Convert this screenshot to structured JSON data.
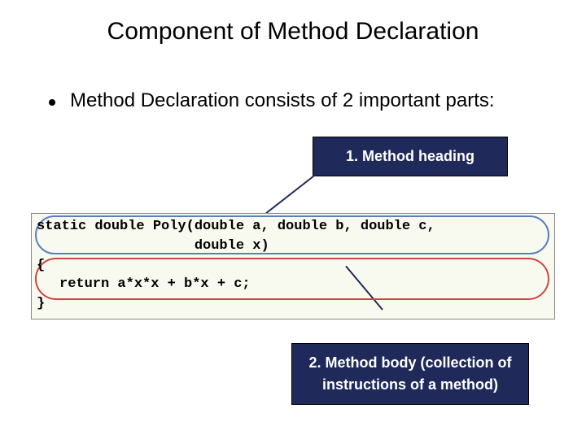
{
  "title": "Component of Method Declaration",
  "bullet": "Method Declaration consists of 2 important parts:",
  "callout1": "1. Method heading",
  "callout2_line1": "2. Method body (collection of",
  "callout2_line2": "instructions of a method)",
  "code": {
    "l1": "static double Poly(double a, double b, double c,",
    "l2": "                   double x)",
    "l3": "{",
    "l4": "return a*x*x + b*x + c;",
    "l5": "}"
  }
}
